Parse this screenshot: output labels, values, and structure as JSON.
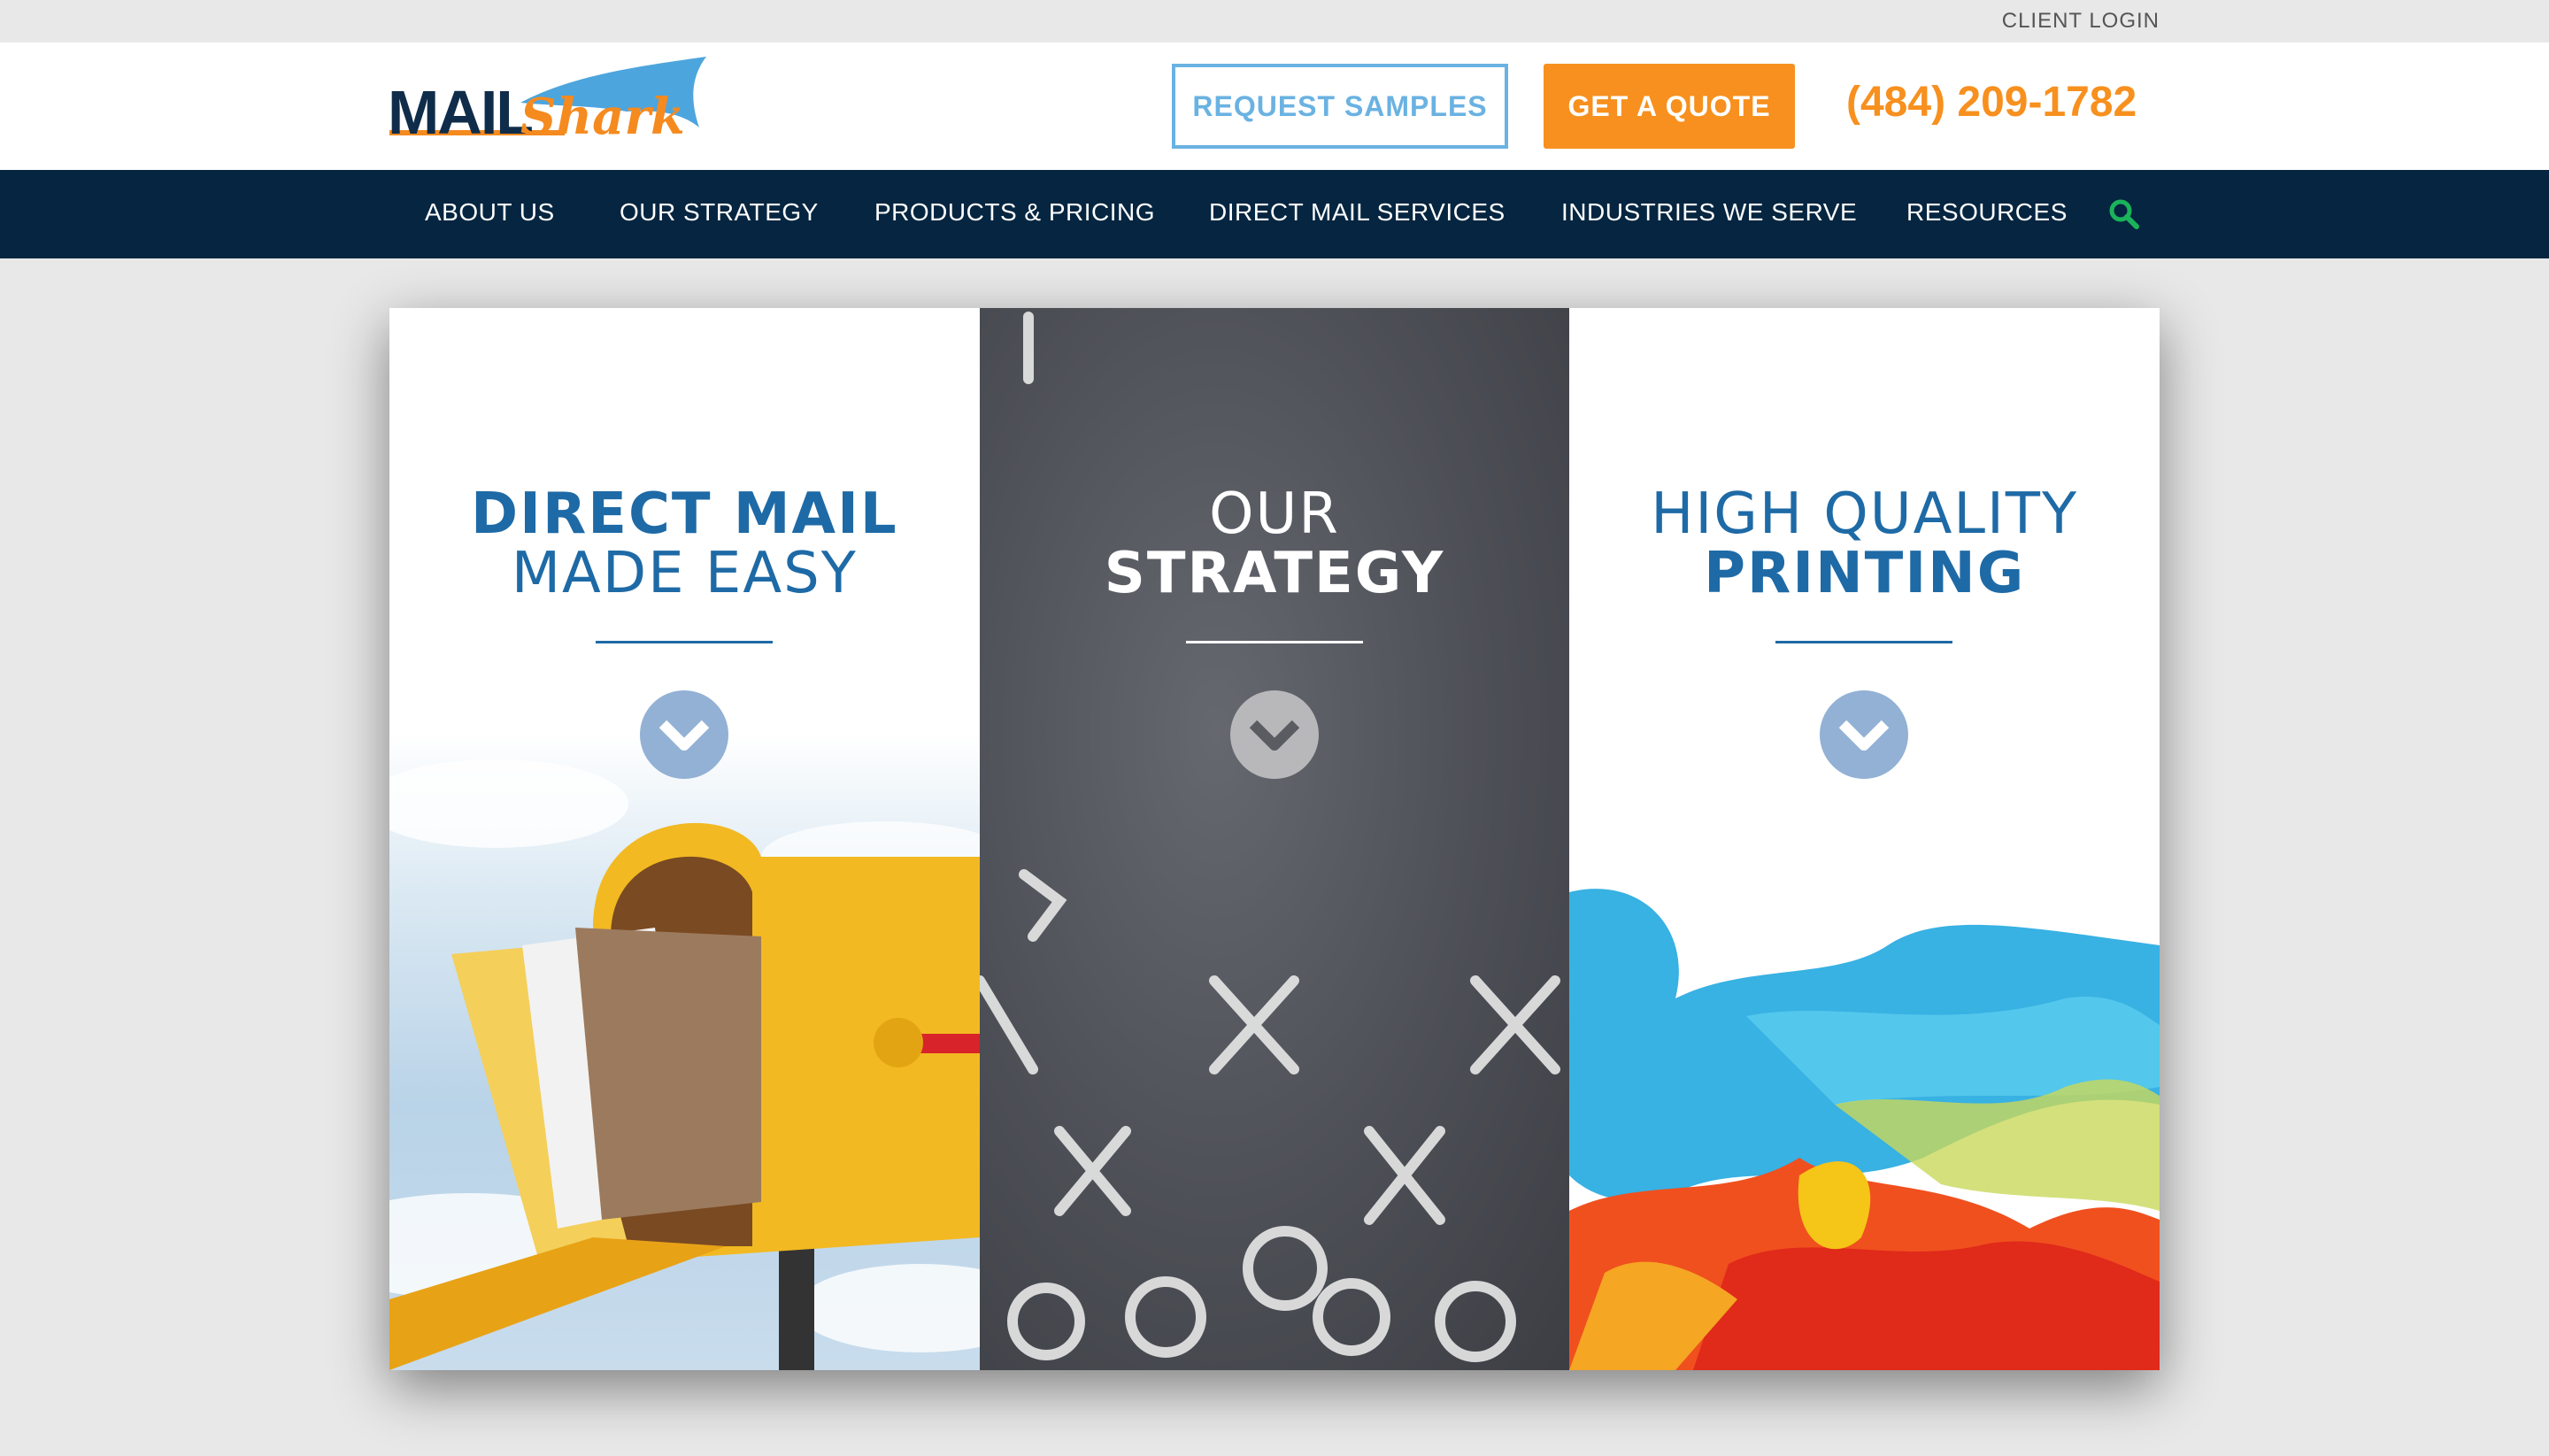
{
  "utility": {
    "client_login": "CLIENT LOGIN"
  },
  "header": {
    "logo_mail": "MAIL",
    "logo_shark": "Shark",
    "request_samples": "REQUEST SAMPLES",
    "get_quote": "GET A QUOTE",
    "phone": "(484) 209-1782"
  },
  "nav": {
    "items": [
      {
        "label": "ABOUT US"
      },
      {
        "label": "OUR STRATEGY"
      },
      {
        "label": "PRODUCTS & PRICING"
      },
      {
        "label": "DIRECT MAIL SERVICES"
      },
      {
        "label": "INDUSTRIES WE SERVE"
      },
      {
        "label": "RESOURCES"
      }
    ]
  },
  "panels": [
    {
      "line1": "DIRECT MAIL",
      "line2": "MADE EASY",
      "title_color": "#1e6aa6"
    },
    {
      "line1": "OUR",
      "line2": "STRATEGY",
      "title_color": "#ffffff"
    },
    {
      "line1": "HIGH QUALITY",
      "line2": "PRINTING",
      "title_color": "#1e6aa6"
    }
  ],
  "colors": {
    "brand_navy": "#052540",
    "brand_orange": "#f7901e",
    "brand_light_blue": "#6ab2e2",
    "search_icon": "#1bb35a",
    "chevron_bg": "#92b1d4"
  }
}
